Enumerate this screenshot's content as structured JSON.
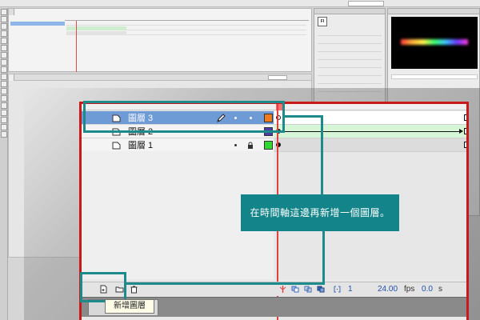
{
  "colors": {
    "highlight_teal": "#1d8a8c",
    "callout_teal": "#138489",
    "zoom_border_red": "#c8191b",
    "selected_layer_blue": "#6e9ad6",
    "layer3_color": "#f07a1c",
    "layer2_color": "#4d3ca8",
    "layer1_color": "#32d832",
    "tween_green": "#d7f5d7"
  },
  "layers": [
    {
      "name": "圖層 3",
      "selected": true,
      "swatch": "#f07a1c",
      "frames": "empty"
    },
    {
      "name": "圖層 2",
      "selected": false,
      "swatch": "#4d3ca8",
      "frames": "tween"
    },
    {
      "name": "圖層 1",
      "selected": false,
      "swatch": "#32d832",
      "frames": "static"
    }
  ],
  "bottom_bar": {
    "current_frame": "1",
    "fps_value": "24.00",
    "fps_unit": "fps",
    "time_value": "0.0",
    "time_unit": "s"
  },
  "callout": {
    "text": "在時間軸這邊再新增一個圖層。"
  },
  "tooltip": {
    "text": "新增圖層"
  },
  "icons": {
    "new_layer": "new-layer-icon",
    "new_folder": "new-folder-icon",
    "delete": "trash-icon",
    "pencil": "pencil-icon",
    "lock": "lock-icon",
    "page": "layer-page-icon"
  }
}
